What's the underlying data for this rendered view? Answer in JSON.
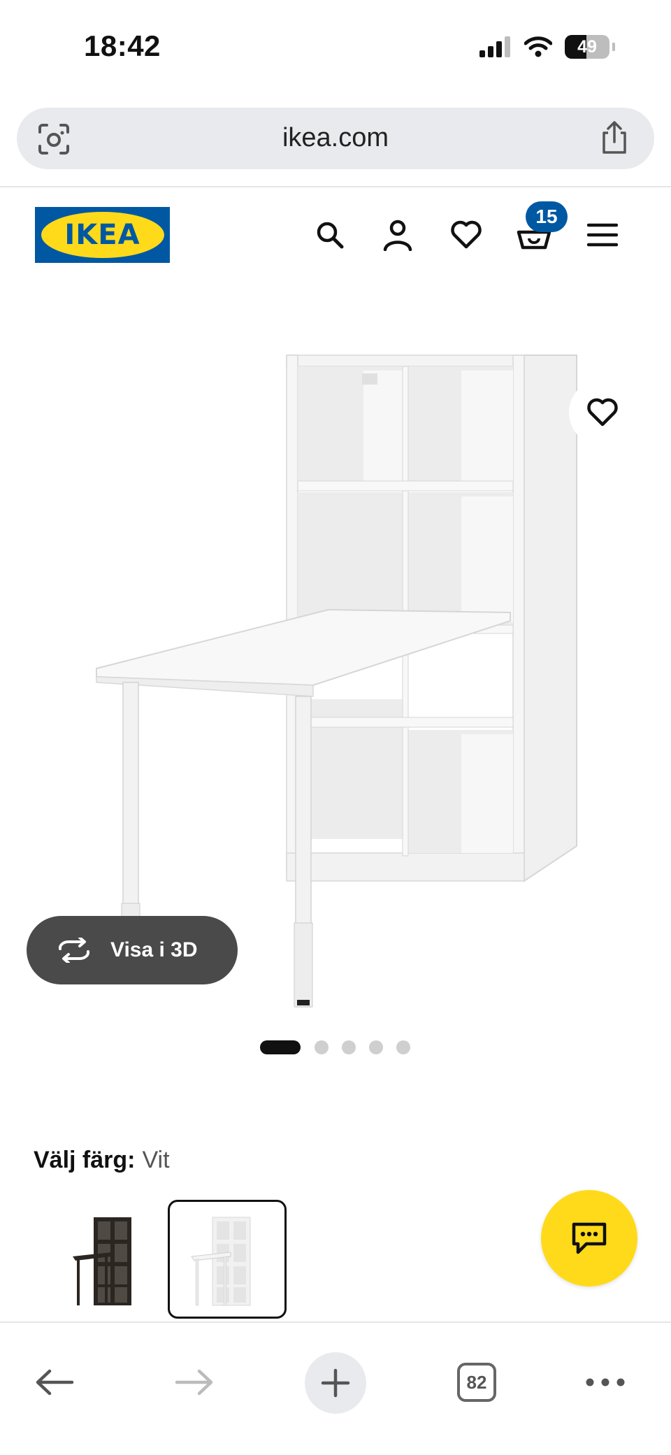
{
  "status_bar": {
    "time": "18:42",
    "battery": "49",
    "battery_level": 0.49
  },
  "browser": {
    "url": "ikea.com"
  },
  "header": {
    "logo_text": "IKEA",
    "cart_count": "15"
  },
  "product": {
    "view_3d_label": "Visa i 3D",
    "carousel": {
      "total": 5,
      "active": 0
    }
  },
  "color_chooser": {
    "label": "Välj färg:",
    "selected": "Vit",
    "options": [
      {
        "name": "svartbrun",
        "selected": false
      },
      {
        "name": "Vit",
        "selected": true
      }
    ]
  },
  "toolbar": {
    "tab_count": "82"
  },
  "colors": {
    "ikea_blue": "#0058a3",
    "ikea_yellow": "#ffda1a"
  },
  "icons": [
    "camera-search-icon",
    "share-icon",
    "search-icon",
    "account-icon",
    "heart-icon",
    "cart-icon",
    "menu-icon",
    "rotate-3d-icon",
    "chat-icon",
    "back-arrow-icon",
    "forward-arrow-icon",
    "plus-icon",
    "tabs-icon",
    "more-icon"
  ]
}
